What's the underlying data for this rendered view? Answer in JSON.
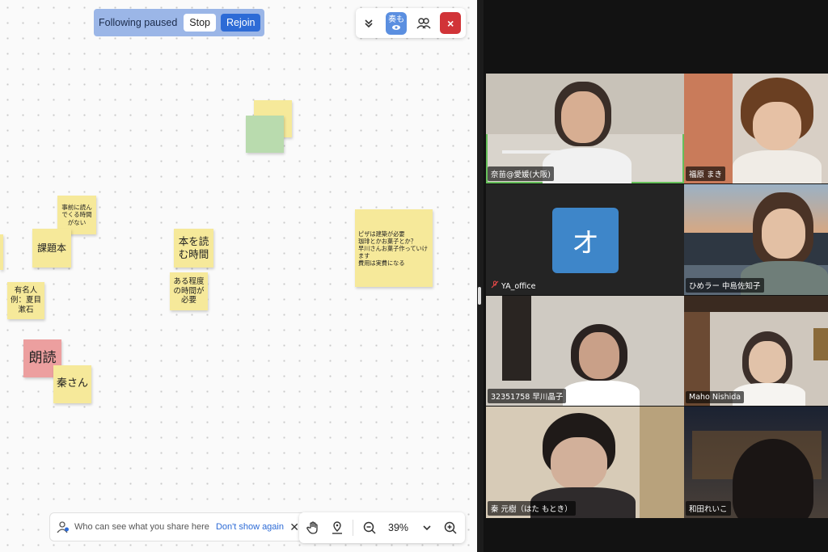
{
  "follow_banner": {
    "status": "Following paused",
    "stop_label": "Stop",
    "rejoin_label": "Rejoin"
  },
  "top_tools": {
    "viewer_initials": "奏も",
    "close_label": "×"
  },
  "notes": [
    "事前に読んでくる時間がない",
    "課題本",
    "本を読む時間",
    "ある程度の時間が必要",
    "有名人例：夏目漱石",
    "朗読",
    "秦さん",
    "ピザは建築が必要\n珈琲とかお菓子とか？\n早川さんお菓子作っていけます\n費用は実費になる"
  ],
  "share_hint": {
    "text": "Who can see what you share here",
    "link": "Don't show again",
    "close": "✕"
  },
  "zoom": {
    "level": "39%"
  },
  "participants": [
    {
      "name": "奈苗@愛媛(大阪)"
    },
    {
      "name": "福原 まき"
    },
    {
      "name": "YA_office",
      "avatar_letter": "オ"
    },
    {
      "name": "ひめラー 中島佐知子"
    },
    {
      "name": "32351758 早川晶子"
    },
    {
      "name": "Maho Nishida"
    },
    {
      "name": "秦 元樹（はた もとき）"
    },
    {
      "name": "和田れいこ"
    }
  ],
  "colors": {
    "note_yellow": "#f6e99a",
    "note_green": "#b9dbae",
    "note_pink": "#ec9f9f",
    "accent_blue": "#2d6bd6",
    "active_speaker": "#66c05a",
    "close_red": "#d13438"
  }
}
